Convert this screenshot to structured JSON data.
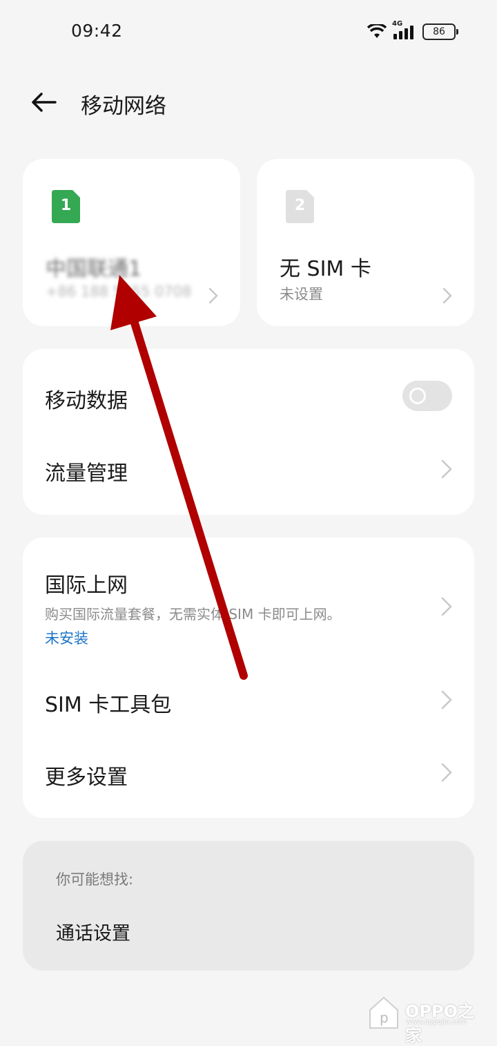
{
  "status_bar": {
    "time": "09:42",
    "network": "4G",
    "battery": "86"
  },
  "header": {
    "title": "移动网络"
  },
  "sim_cards": [
    {
      "slot": "1",
      "name": "中国联通1",
      "number": "+86 188 5555 0708",
      "badge_color": "#34a853"
    },
    {
      "slot": "2",
      "name": "无 SIM 卡",
      "status": "未设置",
      "badge_color": "#e0e0e0"
    }
  ],
  "data_section": {
    "mobile_data": {
      "label": "移动数据",
      "enabled": false
    },
    "traffic": {
      "label": "流量管理"
    }
  },
  "more_section": {
    "intl": {
      "label": "国际上网",
      "desc": "购买国际流量套餐，无需实体 SIM 卡即可上网。",
      "status": "未安装"
    },
    "toolkit": {
      "label": "SIM 卡工具包"
    },
    "more": {
      "label": "更多设置"
    }
  },
  "suggest": {
    "title": "你可能想找:",
    "items": [
      "通话设置"
    ]
  },
  "watermark": {
    "brand": "OPPO之家",
    "url": "www.oppojia.com"
  },
  "colors": {
    "accent_link": "#1a73c7",
    "annotation_arrow": "#b00000",
    "sim1_badge": "#34a853"
  }
}
